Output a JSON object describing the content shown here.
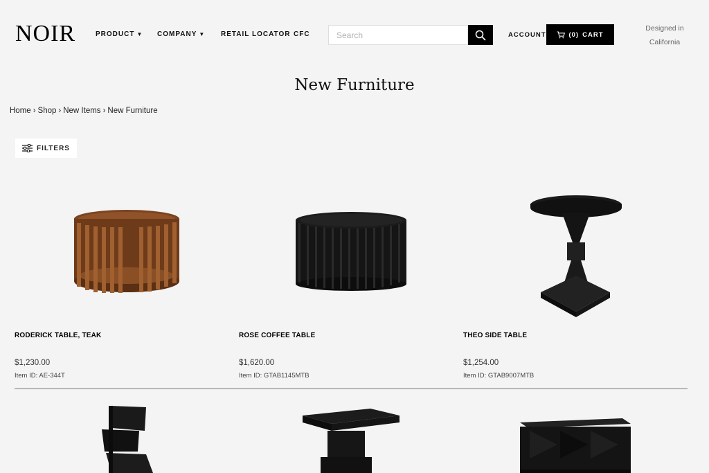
{
  "header": {
    "logo": "NOIR",
    "nav": [
      {
        "label": "PRODUCT",
        "has_dropdown": true
      },
      {
        "label": "COMPANY",
        "has_dropdown": true
      },
      {
        "label": "RETAIL LOCATOR",
        "has_dropdown": false
      },
      {
        "label": "CFC",
        "has_dropdown": false
      }
    ],
    "search": {
      "placeholder": "Search",
      "value": "",
      "icon": "search-icon"
    },
    "account_label": "ACCOUNT",
    "cart": {
      "count": "(0)",
      "label": "CART",
      "icon": "cart-icon"
    },
    "tagline_line1": "Designed in",
    "tagline_line2": "California"
  },
  "page": {
    "title": "New Furniture",
    "breadcrumb": [
      {
        "label": "Home"
      },
      {
        "label": "Shop"
      },
      {
        "label": "New Items"
      },
      {
        "label": "New Furniture"
      }
    ],
    "breadcrumb_sep": "›",
    "filters_label": "FILTERS"
  },
  "products": [
    {
      "name": "RODERICK TABLE, TEAK",
      "price": "$1,230.00",
      "item_id": "Item ID: AE-344T",
      "image": "round-slatted-teak-coffee-table"
    },
    {
      "name": "ROSE COFFEE TABLE",
      "price": "$1,620.00",
      "item_id": "Item ID: GTAB1145MTB",
      "image": "black-fluted-round-coffee-table"
    },
    {
      "name": "THEO SIDE TABLE",
      "price": "$1,254.00",
      "item_id": "Item ID: GTAB9007MTB",
      "image": "black-pedestal-side-table"
    }
  ],
  "products_row2_images": [
    "black-angular-sculptural-chair",
    "black-block-pedestal-table",
    "black-faceted-sideboard"
  ],
  "colors": {
    "background": "#f4f4f4",
    "accent": "#000000",
    "teak": "#8b4f26"
  }
}
